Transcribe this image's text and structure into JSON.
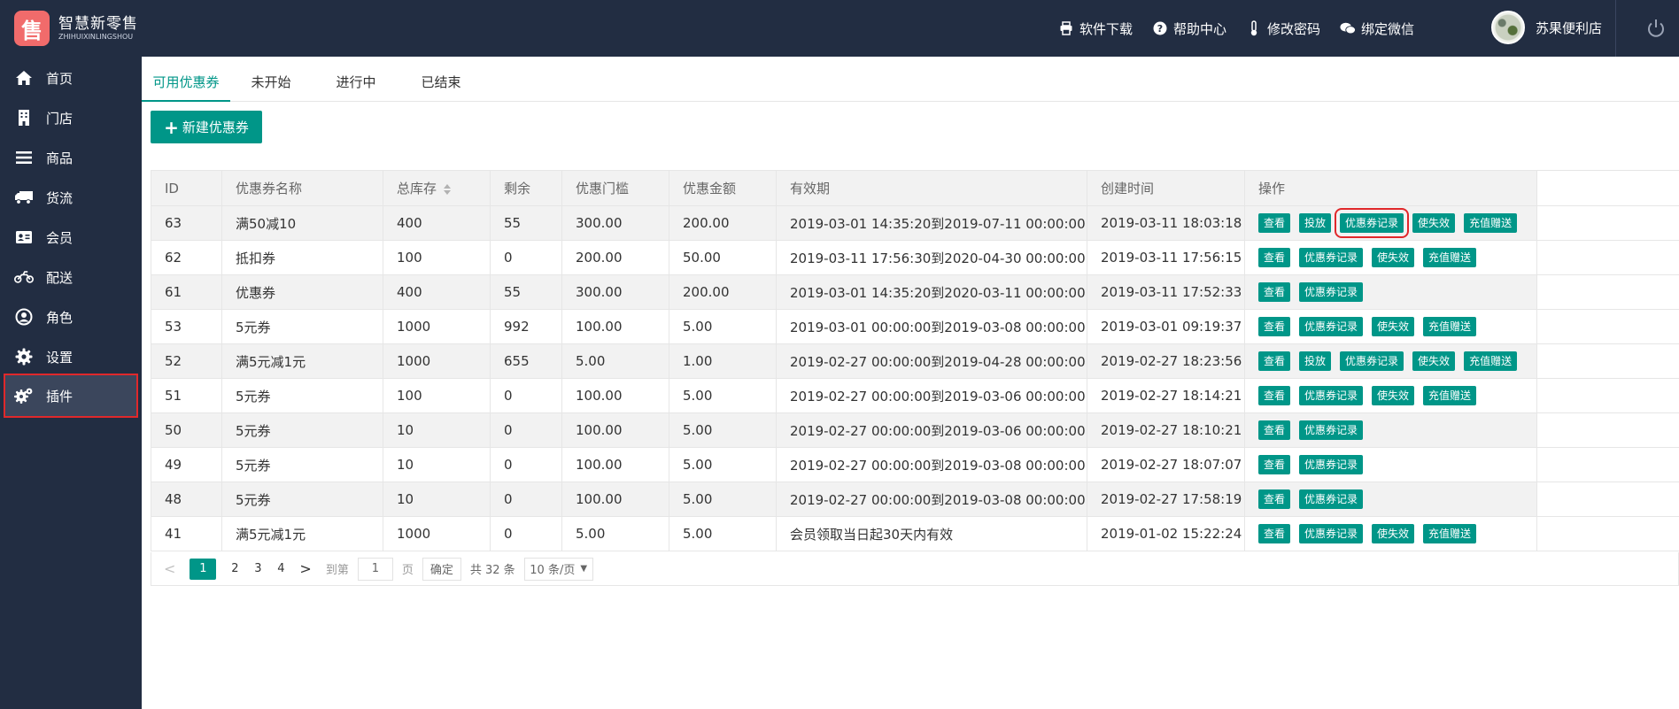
{
  "app": {
    "logo_char": "售",
    "logo_title": "智慧新零售",
    "logo_sub": "ZHIHUIXINLINGSHOU"
  },
  "header": {
    "links": [
      {
        "label": "软件下载",
        "icon": "printer-icon"
      },
      {
        "label": "帮助中心",
        "icon": "help-icon"
      },
      {
        "label": "修改密码",
        "icon": "thermometer-icon"
      },
      {
        "label": "绑定微信",
        "icon": "wechat-icon"
      }
    ],
    "user_name": "苏果便利店"
  },
  "sidebar": {
    "items": [
      {
        "label": "首页",
        "icon": "home-icon"
      },
      {
        "label": "门店",
        "icon": "building-icon"
      },
      {
        "label": "商品",
        "icon": "list-icon"
      },
      {
        "label": "货流",
        "icon": "truck-icon"
      },
      {
        "label": "会员",
        "icon": "member-card-icon"
      },
      {
        "label": "配送",
        "icon": "motorcycle-icon"
      },
      {
        "label": "角色",
        "icon": "user-circle-icon"
      },
      {
        "label": "设置",
        "icon": "gear-icon"
      },
      {
        "label": "插件",
        "icon": "gears-icon",
        "active": true
      }
    ]
  },
  "tabs": [
    "可用优惠券",
    "未开始",
    "进行中",
    "已结束"
  ],
  "new_coupon_button": "新建优惠券",
  "table": {
    "columns": [
      "ID",
      "优惠券名称",
      "总库存",
      "剩余",
      "优惠门槛",
      "优惠金额",
      "有效期",
      "创建时间",
      "操作"
    ],
    "rows": [
      {
        "id": "63",
        "name": "满50减10",
        "stock": "400",
        "remain": "55",
        "threshold": "300.00",
        "amount": "200.00",
        "validity": "2019-03-01 14:35:20到2019-07-11 00:00:00",
        "created": "2019-03-11 18:03:18",
        "actions": [
          "查看",
          "投放",
          "优惠券记录",
          "使失效",
          "充值赠送"
        ]
      },
      {
        "id": "62",
        "name": "抵扣券",
        "stock": "100",
        "remain": "0",
        "threshold": "200.00",
        "amount": "50.00",
        "validity": "2019-03-11 17:56:30到2020-04-30 00:00:00",
        "created": "2019-03-11 17:56:15",
        "actions": [
          "查看",
          "优惠券记录",
          "使失效",
          "充值赠送"
        ]
      },
      {
        "id": "61",
        "name": "优惠券",
        "stock": "400",
        "remain": "55",
        "threshold": "300.00",
        "amount": "200.00",
        "validity": "2019-03-01 14:35:20到2020-03-11 00:00:00",
        "created": "2019-03-11 17:52:33",
        "actions": [
          "查看",
          "优惠券记录"
        ]
      },
      {
        "id": "53",
        "name": "5元券",
        "stock": "1000",
        "remain": "992",
        "threshold": "100.00",
        "amount": "5.00",
        "validity": "2019-03-01 00:00:00到2019-03-08 00:00:00",
        "created": "2019-03-01 09:19:37",
        "actions": [
          "查看",
          "优惠券记录",
          "使失效",
          "充值赠送"
        ]
      },
      {
        "id": "52",
        "name": "满5元减1元",
        "stock": "1000",
        "remain": "655",
        "threshold": "5.00",
        "amount": "1.00",
        "validity": "2019-02-27 00:00:00到2019-04-28 00:00:00",
        "created": "2019-02-27 18:23:56",
        "actions": [
          "查看",
          "投放",
          "优惠券记录",
          "使失效",
          "充值赠送"
        ]
      },
      {
        "id": "51",
        "name": "5元券",
        "stock": "100",
        "remain": "0",
        "threshold": "100.00",
        "amount": "5.00",
        "validity": "2019-02-27 00:00:00到2019-03-06 00:00:00",
        "created": "2019-02-27 18:14:21",
        "actions": [
          "查看",
          "优惠券记录",
          "使失效",
          "充值赠送"
        ]
      },
      {
        "id": "50",
        "name": "5元券",
        "stock": "10",
        "remain": "0",
        "threshold": "100.00",
        "amount": "5.00",
        "validity": "2019-02-27 00:00:00到2019-03-06 00:00:00",
        "created": "2019-02-27 18:10:21",
        "actions": [
          "查看",
          "优惠券记录"
        ]
      },
      {
        "id": "49",
        "name": "5元券",
        "stock": "10",
        "remain": "0",
        "threshold": "100.00",
        "amount": "5.00",
        "validity": "2019-02-27 00:00:00到2019-03-08 00:00:00",
        "created": "2019-02-27 18:07:07",
        "actions": [
          "查看",
          "优惠券记录"
        ]
      },
      {
        "id": "48",
        "name": "5元券",
        "stock": "10",
        "remain": "0",
        "threshold": "100.00",
        "amount": "5.00",
        "validity": "2019-02-27 00:00:00到2019-03-08 00:00:00",
        "created": "2019-02-27 17:58:19",
        "actions": [
          "查看",
          "优惠券记录"
        ]
      },
      {
        "id": "41",
        "name": "满5元减1元",
        "stock": "1000",
        "remain": "0",
        "threshold": "5.00",
        "amount": "5.00",
        "validity": "会员领取当日起30天内有效",
        "created": "2019-01-02 15:22:24",
        "actions": [
          "查看",
          "优惠券记录",
          "使失效",
          "充值赠送"
        ]
      }
    ]
  },
  "pagination": {
    "pages": [
      "1",
      "2",
      "3",
      "4"
    ],
    "current": "1",
    "goto_label": "到第",
    "goto_value": "1",
    "page_suffix": "页",
    "confirm": "确定",
    "total": "共 32 条",
    "page_size": "10 条/页"
  },
  "colors": {
    "primary": "#009688",
    "sidebar_bg": "#222d42",
    "highlight": "#e0282b"
  }
}
